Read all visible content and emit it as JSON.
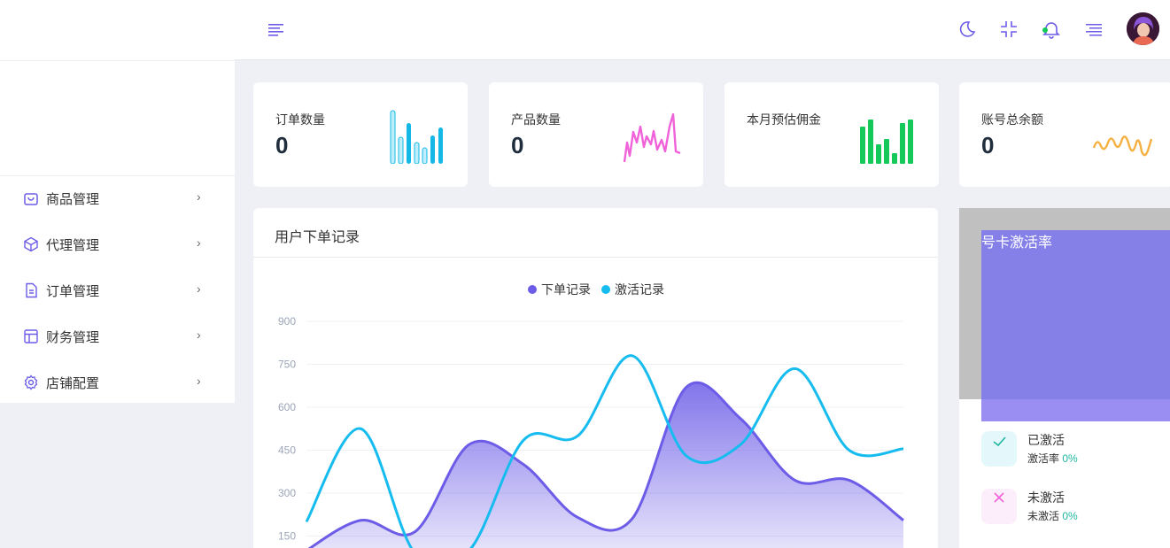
{
  "header": {
    "icons": [
      "menu-icon",
      "moon-icon",
      "fullscreen-exit-icon",
      "bell-icon",
      "list-icon"
    ]
  },
  "sidebar": {
    "items": [
      {
        "label": "商品管理",
        "icon": "shopping-bag-icon"
      },
      {
        "label": "代理管理",
        "icon": "cube-icon"
      },
      {
        "label": "订单管理",
        "icon": "document-icon"
      },
      {
        "label": "财务管理",
        "icon": "layout-icon"
      },
      {
        "label": "店铺配置",
        "icon": "gear-icon"
      }
    ],
    "arrow": "›"
  },
  "stats": [
    {
      "label": "订单数量",
      "value": "0",
      "color": "#14b8e6",
      "spark": "bar"
    },
    {
      "label": "产品数量",
      "value": "0",
      "color": "#f062d9",
      "spark": "line"
    },
    {
      "label": "本月预估佣金",
      "value": "",
      "color": "#14c95a",
      "spark": "bar"
    },
    {
      "label": "账号总余额",
      "value": "0",
      "color": "#f5b041",
      "spark": "line"
    }
  ],
  "order_chart": {
    "title": "用户下单记录",
    "chart_data": {
      "type": "line",
      "yticks": [
        150,
        300,
        450,
        600,
        750,
        900
      ],
      "ylim": [
        0,
        900
      ],
      "grid": true,
      "legend_position": "top-center",
      "series": [
        {
          "name": "下单记录",
          "color": "#6c5ce7",
          "fill": true,
          "x": [
            0,
            1,
            2,
            3,
            4,
            5,
            6,
            7,
            8,
            9,
            10,
            11
          ],
          "values": [
            100,
            205,
            165,
            470,
            400,
            215,
            210,
            670,
            560,
            345,
            345,
            205
          ]
        },
        {
          "name": "激活记录",
          "color": "#16bcef",
          "fill": false,
          "x": [
            0,
            1,
            2,
            3,
            4,
            5,
            6,
            7,
            8,
            9,
            10,
            11
          ],
          "values": [
            200,
            525,
            90,
            100,
            485,
            500,
            780,
            430,
            470,
            735,
            450,
            455
          ]
        }
      ]
    }
  },
  "activation": {
    "title": "号卡激活率",
    "rows": [
      {
        "name": "已激活",
        "sub_label": "激活率",
        "pct": "0%",
        "icon": "check-icon",
        "color": "#20b7a1"
      },
      {
        "name": "未激活",
        "sub_label": "未激活",
        "pct": "0%",
        "icon": "close-icon",
        "color": "#f062d9"
      }
    ]
  }
}
